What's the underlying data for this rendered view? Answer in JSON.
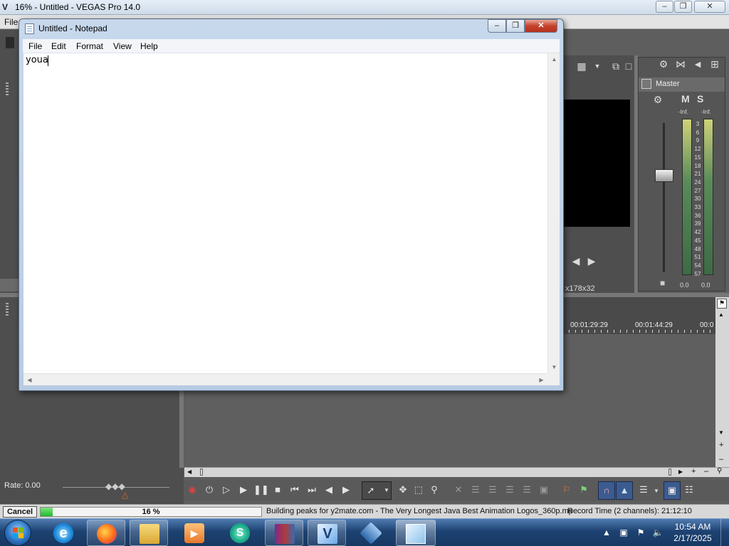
{
  "vegas": {
    "title": "16% - Untitled - VEGAS Pro 14.0",
    "menu_first": "File",
    "preview_res": "x178x32",
    "timecode_1": "00:01:29:29",
    "timecode_2": "00:01:44:29",
    "timecode_3": "00:0",
    "rate_label": "Rate: 0.00",
    "mixer": {
      "master_label": "Master",
      "mute": "M",
      "solo": "S",
      "peak_left": "-Inf.",
      "peak_right": "-Inf.",
      "scale": [
        "3",
        "6",
        "9",
        "12",
        "15",
        "18",
        "21",
        "24",
        "27",
        "30",
        "33",
        "36",
        "39",
        "42",
        "45",
        "48",
        "51",
        "54",
        "57"
      ],
      "level_left": "0.0",
      "level_right": "0.0"
    },
    "status": {
      "cancel_label": "Cancel",
      "progress_percent": "16 %",
      "progress_fraction": 0.16,
      "message": "Building peaks for y2mate.com - The Very Longest Java Best Animation Logos_360p.mp",
      "record_time": "Record Time (2 channels): 21:12:10"
    }
  },
  "notepad": {
    "title": "Untitled - Notepad",
    "menu": [
      "File",
      "Edit",
      "Format",
      "View",
      "Help"
    ],
    "content": "youa"
  },
  "taskbar": {
    "time": "10:54 AM",
    "date": "2/17/2025",
    "items": [
      "internet-explorer",
      "firefox",
      "file-explorer",
      "media-player",
      "app-s",
      "winrar",
      "vegas",
      "virtualbox",
      "notepad"
    ]
  },
  "colors": {
    "vegas_bg": "#5e5e5e",
    "progress_green": "#1dbb2d",
    "notepad_frame": "#b8cbe3",
    "taskbar": "#1d4272"
  }
}
